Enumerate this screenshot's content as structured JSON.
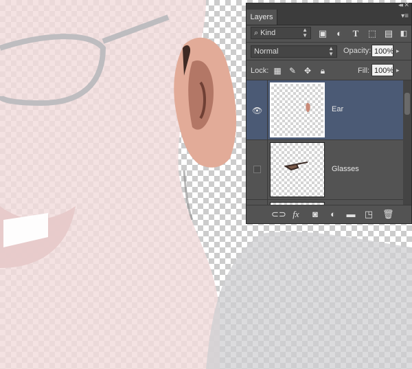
{
  "panel": {
    "tab_label": "Layers",
    "filter": {
      "kind_label": "Kind",
      "icons": [
        "image-filter-icon",
        "adjustment-filter-icon",
        "type-filter-icon",
        "shape-filter-icon",
        "smart-object-filter-icon",
        "filter-toggle-icon"
      ]
    },
    "blend_mode": "Normal",
    "opacity": {
      "label": "Opacity:",
      "value": "100%"
    },
    "lock": {
      "label": "Lock:",
      "icons": [
        "lock-transparent-icon",
        "lock-image-icon",
        "lock-position-icon",
        "lock-all-icon"
      ]
    },
    "fill": {
      "label": "Fill:",
      "value": "100%"
    },
    "layers": [
      {
        "name": "Ear",
        "visible": true,
        "selected": true
      },
      {
        "name": "Glasses",
        "visible": false,
        "selected": false
      }
    ],
    "footer_icons": [
      "link-layers-icon",
      "fx-icon",
      "add-mask-icon",
      "new-adjustment-icon",
      "new-group-icon",
      "new-layer-icon",
      "delete-layer-icon"
    ],
    "colors": {
      "selected_row": "#4b5a75",
      "panel_bg": "#535353"
    }
  }
}
